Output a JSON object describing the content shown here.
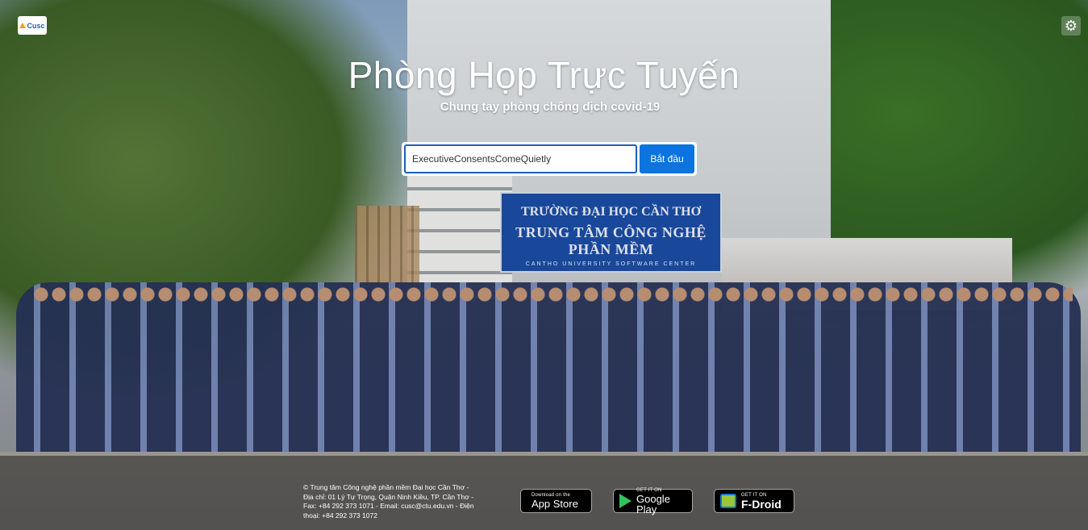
{
  "header": {
    "logo_text": "Cusc",
    "settings_icon": "gear-icon"
  },
  "hero": {
    "title": "Phòng Họp Trực Tuyến",
    "subtitle": "Chung tay phòng chống dịch covid-19"
  },
  "join": {
    "room_name_value": "ExecutiveConsentsComeQuietly",
    "start_button_label": "Bắt đầu"
  },
  "background_sign": {
    "line1": "TRƯỜNG ĐẠI HỌC CẦN THƠ",
    "line2": "TRUNG TÂM CÔNG NGHỆ PHẦN MỀM",
    "line3": "CANTHO UNIVERSITY SOFTWARE CENTER"
  },
  "footer": {
    "line1": "© Trung tâm Công nghệ phần mềm Đại học Cần Thơ -",
    "line2": "Địa chỉ: 01 Lý Tự Trọng, Quận Ninh Kiều, TP. Cần Thơ -",
    "line3": "Fax: +84 292 373 1071 - Email: cusc@ctu.edu.vn - Điện",
    "line4": "thoại: +84 292 373 1072"
  },
  "stores": {
    "appstore": {
      "small": "Download on the",
      "big": "App Store",
      "icon": "apple-icon"
    },
    "googleplay": {
      "small": "GET IT ON",
      "big": "Google Play",
      "icon": "google-play-icon"
    },
    "fdroid": {
      "small": "GET IT ON",
      "big": "F-Droid",
      "icon": "fdroid-icon"
    }
  },
  "colors": {
    "accent": "#0b74de",
    "input_border": "#1c5ec0"
  }
}
